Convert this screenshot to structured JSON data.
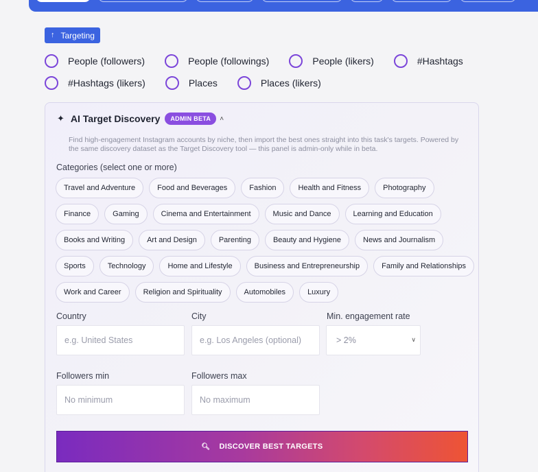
{
  "targeting_button": {
    "label": "Targeting",
    "icon": "arrow-up-icon"
  },
  "source_types": {
    "row1": [
      "People (followers)",
      "People (followings)",
      "People (likers)",
      "#Hashtags"
    ],
    "row2": [
      "#Hashtags (likers)",
      "Places",
      "Places (likers)"
    ]
  },
  "ai_panel": {
    "title": "AI Target Discovery",
    "badge": "ADMIN BETA",
    "description": "Find high-engagement Instagram accounts by niche, then import the best ones straight into this task's targets. Powered by the same discovery dataset as the Target Discovery tool — this panel is admin-only while in beta.",
    "categories_label": "Categories (select one or more)",
    "categories": [
      [
        "Travel and Adventure",
        "Food and Beverages",
        "Fashion",
        "Health and Fitness",
        "Photography"
      ],
      [
        "Finance",
        "Gaming",
        "Cinema and Entertainment",
        "Music and Dance",
        "Learning and Education"
      ],
      [
        "Books and Writing",
        "Art and Design",
        "Parenting",
        "Beauty and Hygiene",
        "News and Journalism"
      ],
      [
        "Sports",
        "Technology",
        "Home and Lifestyle",
        "Business and Entrepreneurship",
        "Family and Relationships"
      ],
      [
        "Work and Career",
        "Religion and Spirituality",
        "Automobiles",
        "Luxury"
      ]
    ],
    "country": {
      "label": "Country",
      "placeholder": "e.g. United States"
    },
    "city": {
      "label": "City",
      "placeholder": "e.g. Los Angeles (optional)"
    },
    "engagement": {
      "label": "Min. engagement rate",
      "value": "> 2%"
    },
    "followers_min": {
      "label": "Followers min",
      "placeholder": "No minimum"
    },
    "followers_max": {
      "label": "Followers max",
      "placeholder": "No maximum"
    },
    "discover_button": "DISCOVER BEST TARGETS"
  },
  "colors": {
    "primary": "#3b63e0",
    "accent": "#7b45d9",
    "badge": "#8a4ee0"
  }
}
